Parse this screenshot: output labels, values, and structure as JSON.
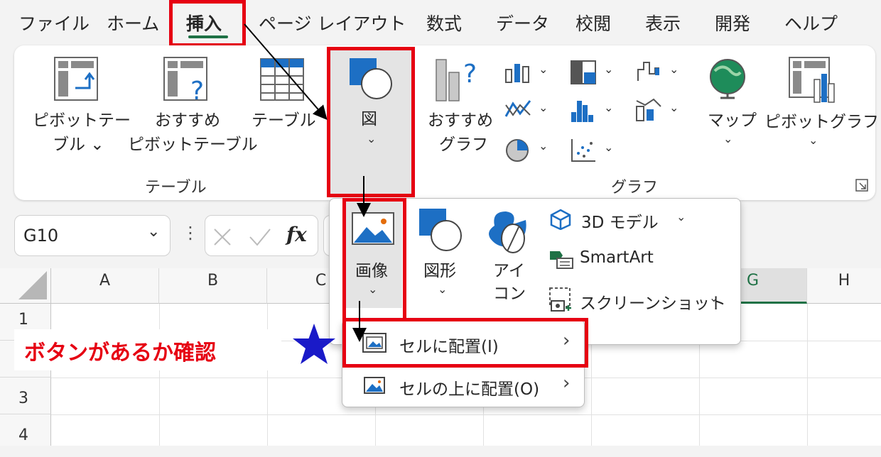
{
  "menu_tabs": [
    "ファイル",
    "ホーム",
    "挿入",
    "ページ レイアウト",
    "数式",
    "データ",
    "校閲",
    "表示",
    "開発",
    "ヘルプ"
  ],
  "active_tab": "挿入",
  "ribbon": {
    "pivot_table": [
      "ピボットテー",
      "ブル ⌄"
    ],
    "recommended_pivot": [
      "おすすめ",
      "ピボットテーブル"
    ],
    "table": "テーブル",
    "figure": "図",
    "recommended_charts": [
      "おすすめ",
      "グラフ"
    ],
    "map": "マップ",
    "pivot_chart": "ピボットグラフ",
    "group_table": "テーブル",
    "group_chart": "グラフ"
  },
  "name_box": "G10",
  "fx_label": "fx",
  "sheet": {
    "columns": [
      "A",
      "B",
      "C",
      "G",
      "H"
    ],
    "rows": [
      "1",
      "3",
      "4"
    ]
  },
  "dropdown": {
    "image": "画像",
    "shapes": "図形",
    "icons": [
      "アイ",
      "コン"
    ],
    "model3d": "3D モデル",
    "smartart": "SmartArt",
    "screenshot": "スクリーンショット"
  },
  "submenu": {
    "place_in_cell": "セルに配置(I)",
    "place_over_cells": "セルの上に配置(O)"
  },
  "annotation": "ボタンがあるか確認",
  "colors": {
    "highlight": "#e60012",
    "accent": "#1e7145",
    "star": "#1a1ac8"
  }
}
